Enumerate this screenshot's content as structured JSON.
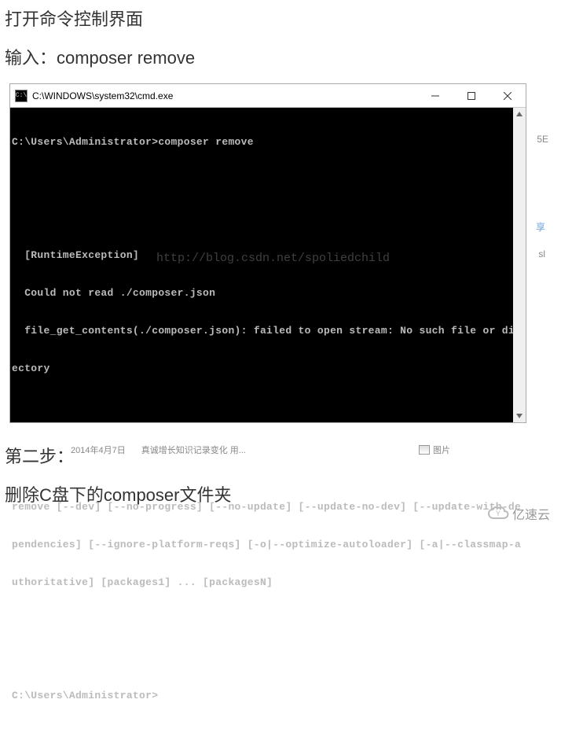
{
  "doc": {
    "line1": "打开命令控制界面",
    "line2": "输入：composer remove",
    "line3": "第二步：",
    "line4": "删除C盘下的composer文件夹"
  },
  "window": {
    "title": "C:\\WINDOWS\\system32\\cmd.exe",
    "icon_label": "C:\\"
  },
  "terminal": {
    "lines": [
      "C:\\Users\\Administrator>composer remove",
      "",
      "",
      "",
      "  [RuntimeException]",
      "  Could not read ./composer.json",
      "  file_get_contents(./composer.json): failed to open stream: No such file or dir",
      "ectory",
      "",
      "",
      "",
      "",
      "remove [--dev] [--no-progress] [--no-update] [--update-no-dev] [--update-with-de",
      "pendencies] [--ignore-platform-reqs] [-o|--optimize-autoloader] [-a|--classmap-a",
      "uthoritative] [packages1] ... [packagesN]",
      "",
      "",
      "",
      "C:\\Users\\Administrator>"
    ],
    "watermark": "http://blog.csdn.net/spoliedchild"
  },
  "clipped": {
    "date_frag": "2014年4月7日",
    "text_frag": "真诚增长知识记录变化 用...",
    "img_label": "图片"
  },
  "brand": {
    "text": "亿速云"
  },
  "bg_hints": {
    "h1": "5E",
    "h2": "享",
    "h3": "sl"
  }
}
